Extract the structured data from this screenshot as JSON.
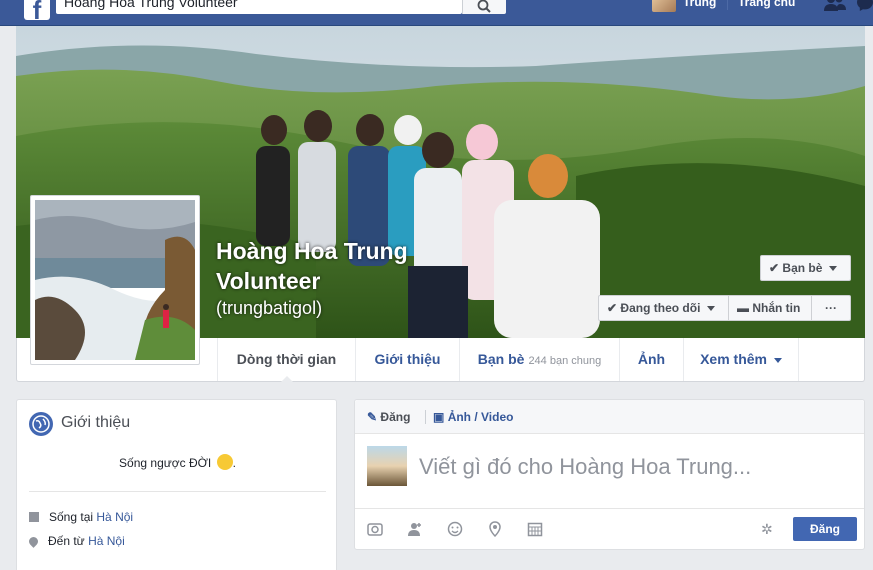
{
  "topbar": {
    "logo": "f",
    "search_value": "Hoàng Hoa Trung Volunteer",
    "user_name": "Trung",
    "home_label": "Trang chủ"
  },
  "profile": {
    "name": "Hoàng Hoa Trung Volunteer",
    "username": "(trungbatigol)"
  },
  "cover_buttons": {
    "friends": "Bạn bè",
    "following": "Đang theo dõi",
    "message": "Nhắn tin",
    "more": "···"
  },
  "tabs": [
    {
      "label": "Dòng thời gian"
    },
    {
      "label": "Giới thiệu"
    },
    {
      "label": "Bạn bè",
      "sub": "244 bạn chung"
    },
    {
      "label": "Ảnh"
    },
    {
      "label": "Xem thêm"
    }
  ],
  "intro": {
    "title": "Giới thiệu",
    "bio": "Sống ngược ĐỜI",
    "lives_prefix": "Sống tại",
    "lives_place": "Hà Nội",
    "from_prefix": "Đến từ",
    "from_place": "Hà Nội"
  },
  "composer": {
    "post_tab": "Đăng",
    "photo_tab": "Ảnh / Video",
    "placeholder": "Viết gì đó cho Hoàng Hoa Trung...",
    "post_button": "Đăng"
  },
  "colors": {
    "brand": "#3b5998",
    "link": "#365899",
    "button": "#4267b2"
  }
}
